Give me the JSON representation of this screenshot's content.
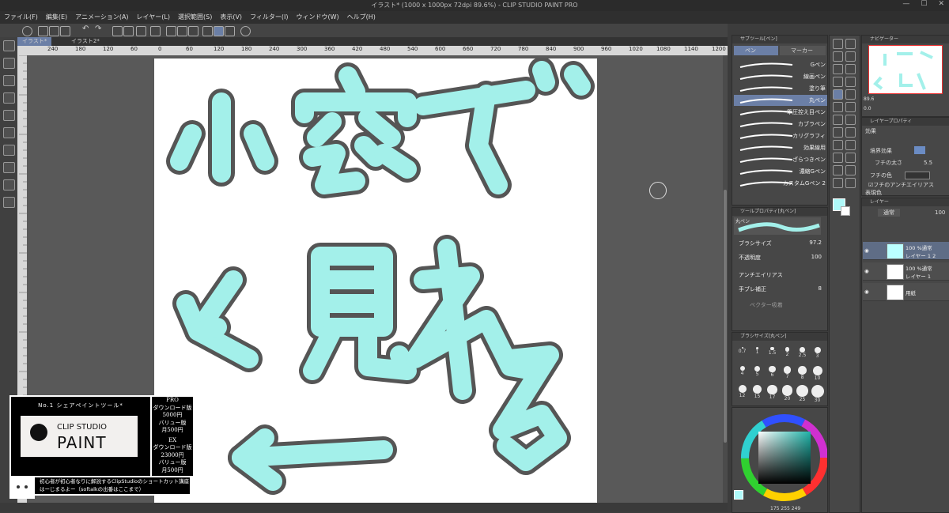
{
  "window": {
    "title": "イラスト* (1000 x 1000px 72dpi 89.6%) - CLIP STUDIO PAINT PRO"
  },
  "menu": [
    "ファイル(F)",
    "編集(E)",
    "アニメーション(A)",
    "レイヤー(L)",
    "選択範囲(S)",
    "表示(V)",
    "フィルター(I)",
    "ウィンドウ(W)",
    "ヘルプ(H)"
  ],
  "tabs": [
    "イラスト*",
    "イラスト2*"
  ],
  "ruler_ticks": [
    "240",
    "180",
    "120",
    "60",
    "0",
    "60",
    "120",
    "180",
    "240",
    "300",
    "360",
    "420",
    "480",
    "540",
    "600",
    "660",
    "720",
    "780",
    "840",
    "900",
    "960",
    "1020",
    "1080",
    "1140",
    "1200",
    "126"
  ],
  "canvas_text": {
    "line1": "小窓で",
    "line2": "見れる"
  },
  "subtool": {
    "header": "サブツール[ペン]",
    "tab_pen": "ペン",
    "tab_marker": "マーカー",
    "brushes": [
      "Gペン",
      "線画ペン",
      "塗り筆",
      "丸ペン",
      "筆圧控え目ペン",
      "カブラペン",
      "カリグラフィ",
      "効果線用",
      "ざらつきペン",
      "濃縮Gペン",
      "カスタムGペン 2"
    ],
    "selected": "丸ペン"
  },
  "tool_property": {
    "header": "ツールプロパティ[丸ペン]",
    "name": "丸ペン",
    "brush_size_label": "ブラシサイズ",
    "brush_size_value": "97.2",
    "opacity_label": "不透明度",
    "opacity_value": "100",
    "antialias_label": "アンチエイリアス",
    "stabilization_label": "手ブレ補正",
    "stabilization_value": "8",
    "vector_label": "ベクター吸着"
  },
  "brush_size_panel": {
    "header": "ブラシサイズ[丸ペン]",
    "row1": [
      "0.7",
      "1",
      "1.5",
      "2",
      "2.5",
      "3"
    ],
    "row2": [
      "4",
      "5",
      "6",
      "7",
      "8",
      "10"
    ],
    "row3": [
      "12",
      "15",
      "17",
      "20",
      "25",
      "30"
    ]
  },
  "navigator": {
    "header": "ナビゲーター",
    "zoom": "89.6",
    "rotate": "0.0"
  },
  "layer_property": {
    "header": "レイヤープロパティ",
    "effect": "効果",
    "border_effect": "境界効果",
    "border_width_label": "フチの太さ",
    "border_width_value": "5.5",
    "border_color_label": "フチの色",
    "border_antialias_label": "フチのアンチエイリアス",
    "expression_label": "表現色"
  },
  "layers": {
    "header": "レイヤー",
    "blend": "通常",
    "opacity": "100",
    "items": [
      {
        "top": "100 %通常",
        "name": "レイヤー 1 2"
      },
      {
        "top": "100 %通常",
        "name": "レイヤー 1"
      },
      {
        "top": "",
        "name": "用紙"
      }
    ]
  },
  "color": {
    "r": "175",
    "g": "255",
    "b": "249",
    "main": "#aff9f9"
  },
  "promo": {
    "tagline": "No.1 シェアペイントツール*",
    "logo_top": "CLIP STUDIO",
    "logo_bottom": "PAINT",
    "pro_title": "PRO",
    "pro_lines": [
      "ダウンロード版",
      "5000円",
      "バリュー版",
      "月500円"
    ],
    "ex_title": "EX",
    "ex_lines": [
      "ダウンロード版",
      "23000円",
      "バリュー版",
      "月500円"
    ],
    "caption_1": "初心者が初心者なりに解説するClipStudioのショートカット講座",
    "caption_2": "はーじまるよー（softalkの出番はここまで）"
  },
  "colors": {
    "stroke_fill": "#a3f0ea",
    "stroke_outline": "#555555",
    "accent": "#6b8cc4"
  }
}
